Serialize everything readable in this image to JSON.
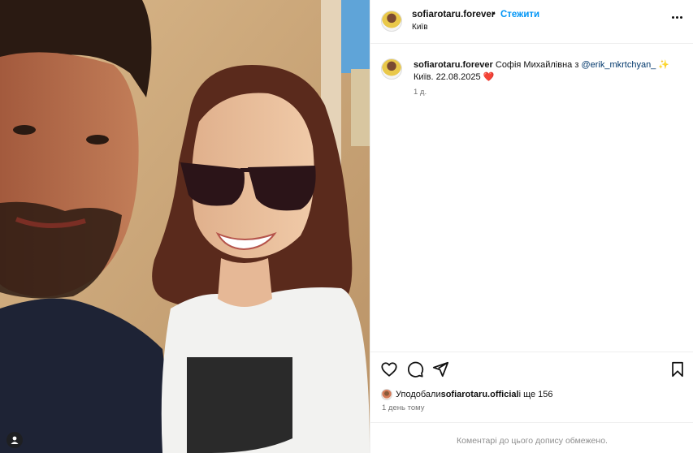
{
  "post": {
    "username": "sofiarotaru.forever",
    "separator": "•",
    "follow_label": "Стежити",
    "location": "Київ",
    "more_icon": "more-horizontal-icon"
  },
  "caption": {
    "username": "sofiarotaru.forever",
    "text_before_mention": " Софія Михайлівна з ",
    "mention": "@erik_mkrtchyan_",
    "emoji_star": "✨",
    "line2": "Київ. 22.08.2025",
    "heart": "❤️",
    "age": "1 д."
  },
  "actions": {
    "like_icon": "heart-icon",
    "comment_icon": "comment-icon",
    "share_icon": "send-icon",
    "save_icon": "bookmark-icon"
  },
  "likes": {
    "prefix": "Уподобали ",
    "by_user": "sofiarotaru.official",
    "suffix": " і ще 156"
  },
  "post_time": "1 день тому",
  "comments_disabled": "Коментарі до цього допису обмежено.",
  "colors": {
    "follow_blue": "#0095f6",
    "mention_blue": "#00376b",
    "muted": "#737373"
  }
}
